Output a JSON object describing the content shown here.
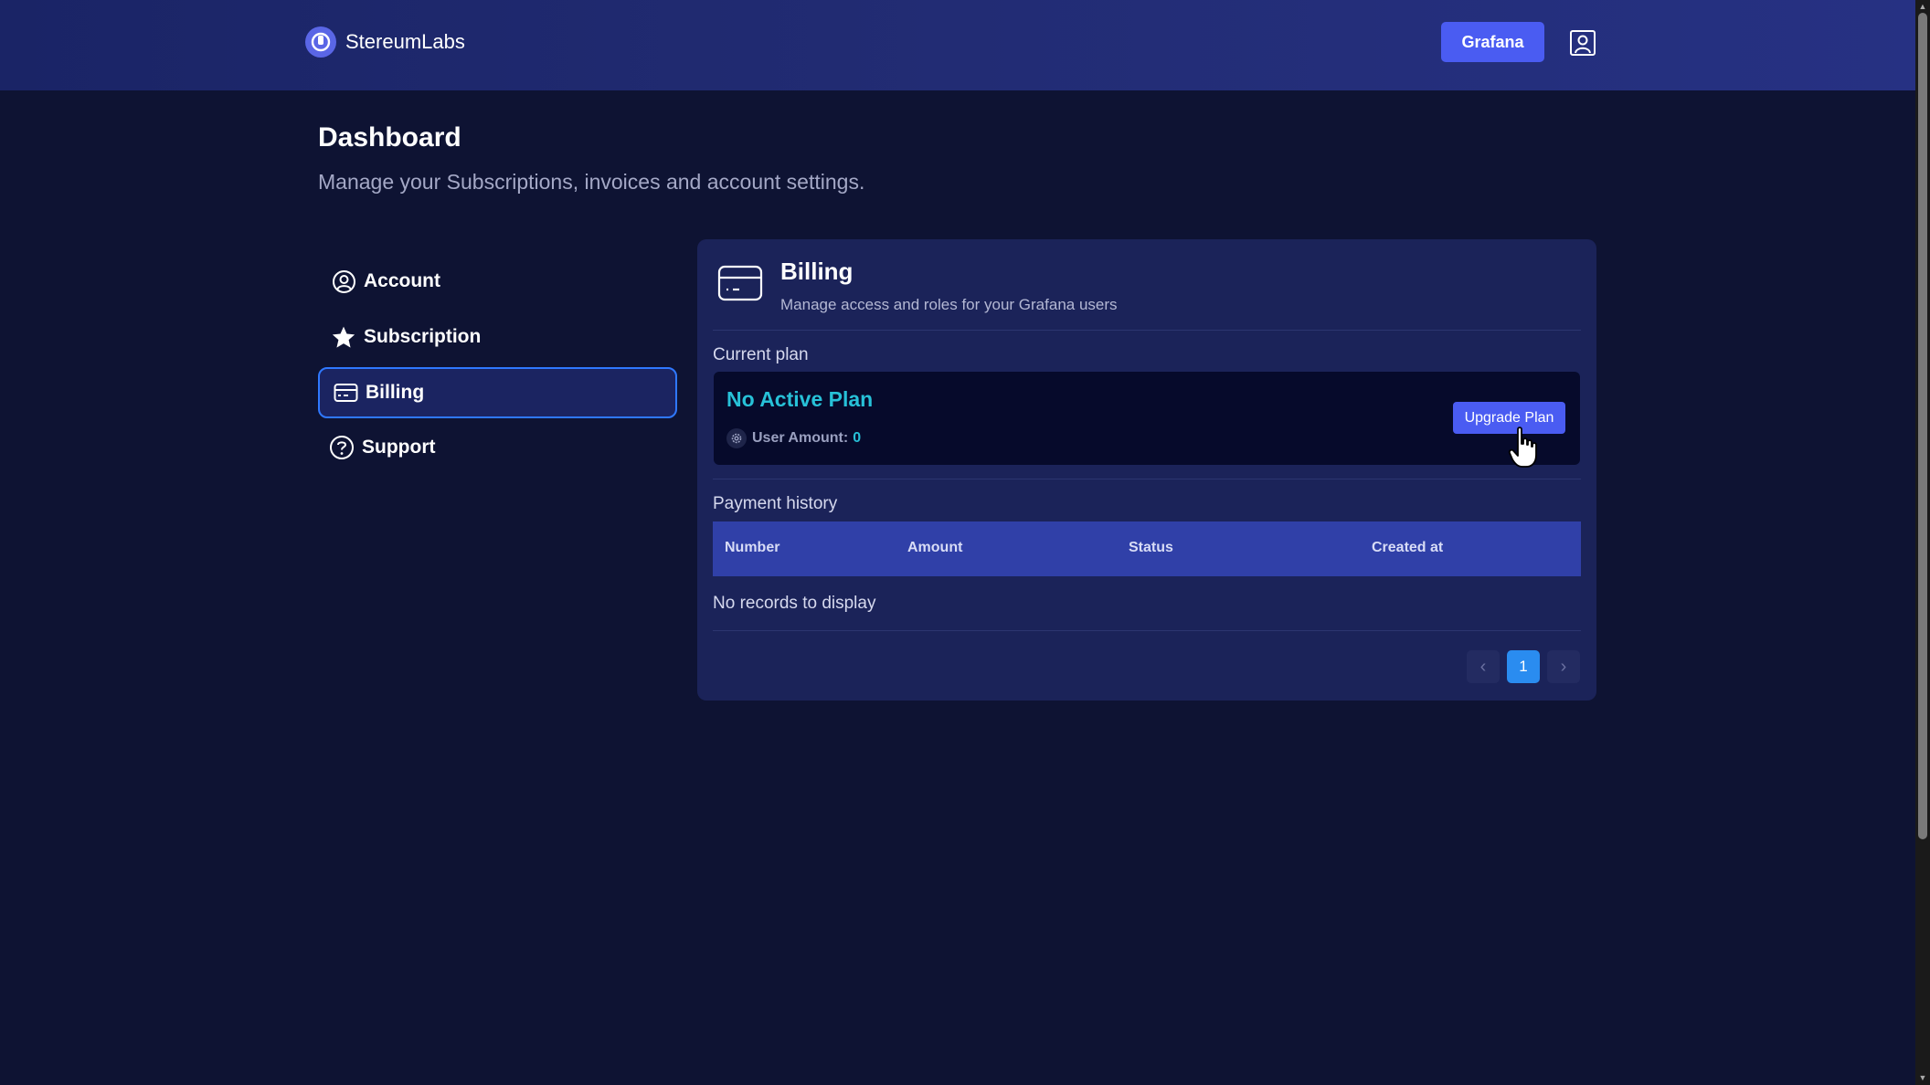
{
  "header": {
    "brand_name": "StereumLabs",
    "grafana_label": "Grafana"
  },
  "page": {
    "title": "Dashboard",
    "subtitle": "Manage your Subscriptions, invoices and account settings."
  },
  "sidebar": {
    "items": [
      {
        "label": "Account",
        "icon": "user-circle-icon"
      },
      {
        "label": "Subscription",
        "icon": "star-icon"
      },
      {
        "label": "Billing",
        "icon": "credit-card-icon",
        "active": true
      },
      {
        "label": "Support",
        "icon": "question-circle-icon"
      }
    ]
  },
  "billing": {
    "title": "Billing",
    "description": "Manage access and roles for your Grafana users",
    "current_plan_label": "Current plan",
    "plan_name": "No Active Plan",
    "user_amount_label": "User Amount:",
    "user_amount_value": "0",
    "upgrade_label": "Upgrade Plan",
    "payment_history_label": "Payment history",
    "columns": [
      "Number",
      "Amount",
      "Status",
      "Created at"
    ],
    "empty_message": "No records to display",
    "pagination": {
      "current_page": "1",
      "prev": "‹",
      "next": "›"
    }
  },
  "colors": {
    "background": "#0e1333",
    "accent": "#4a5cf2",
    "plan_highlight": "#27c1d8",
    "active_border": "#2f78ff"
  }
}
